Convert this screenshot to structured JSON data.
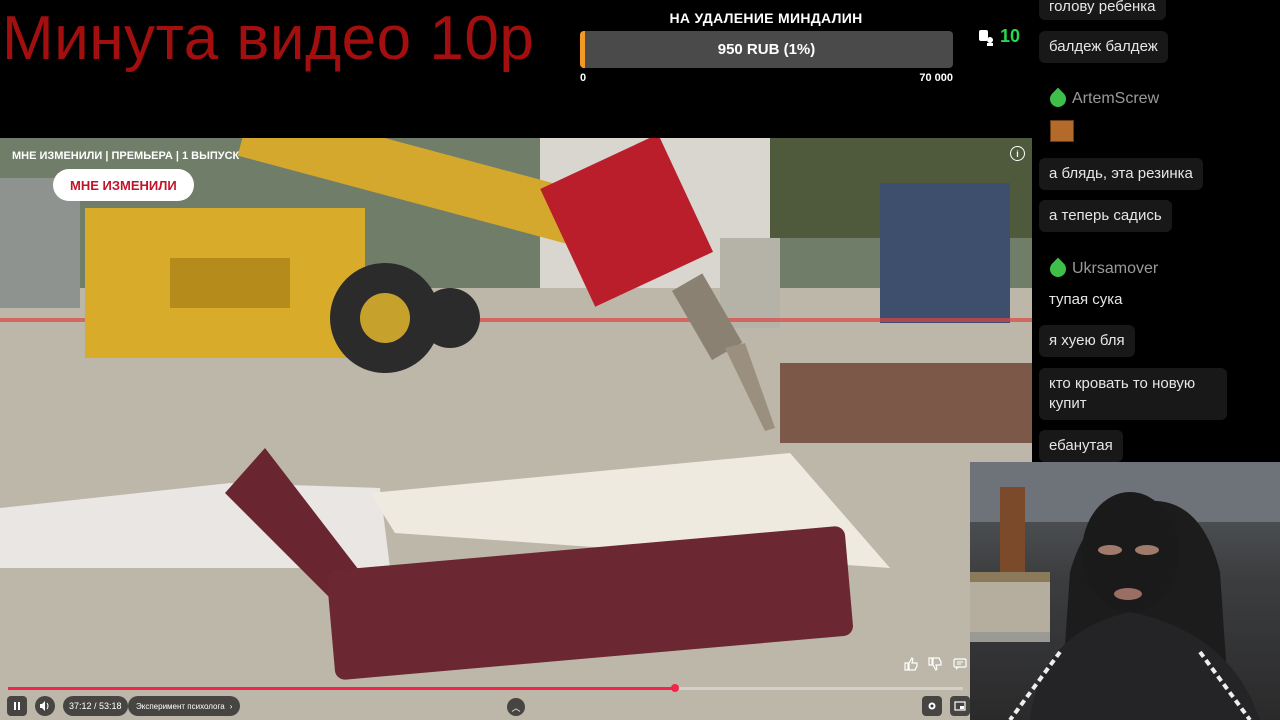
{
  "overlay": {
    "promo_text": "Минута видео 10р",
    "goal_title": "НА УДАЛЕНИЕ МИНДАЛИН",
    "goal_value": "950 RUB (1%)",
    "goal_progress_percent": 1.4,
    "goal_min": "0",
    "goal_max": "70 000",
    "viewer_count": "10",
    "viewer_icon": "viewers-icon",
    "accent_color": "#f29a24",
    "promo_color": "#a30f0f"
  },
  "video": {
    "title": "МНЕ ИЗМЕНИЛИ | ПРЕМЬЕРА | 1 ВЫПУСК",
    "channel_button": "МНЕ ИЗМЕНИЛИ",
    "info_icon": "info-icon",
    "player": {
      "time": "37:12 / 53:18",
      "chapter": "Эксперимент психолога",
      "progress_percent": 69.8,
      "progress_color": "#f3244a",
      "icons": [
        "pause-icon",
        "volume-icon",
        "chevron-up-icon",
        "settings-icon",
        "fullscreen-icon",
        "like-icon",
        "dislike-icon",
        "comment-icon"
      ]
    }
  },
  "chat": {
    "messages": [
      {
        "text": "голову ребенка"
      },
      {
        "text": "балдеж балдеж"
      },
      {
        "author": "ArtemScrew"
      },
      {
        "text": "а блядь, эта резинка"
      },
      {
        "text": "а теперь садись"
      },
      {
        "author": "Ukrsamover"
      },
      {
        "text": "тупая сука"
      },
      {
        "text": "я хуею бля"
      },
      {
        "text": "кто кровать то новую купит"
      },
      {
        "text": "ебанутая"
      }
    ],
    "author_color": "#9a9a9a",
    "badge_icon": "leaf-badge-icon"
  }
}
